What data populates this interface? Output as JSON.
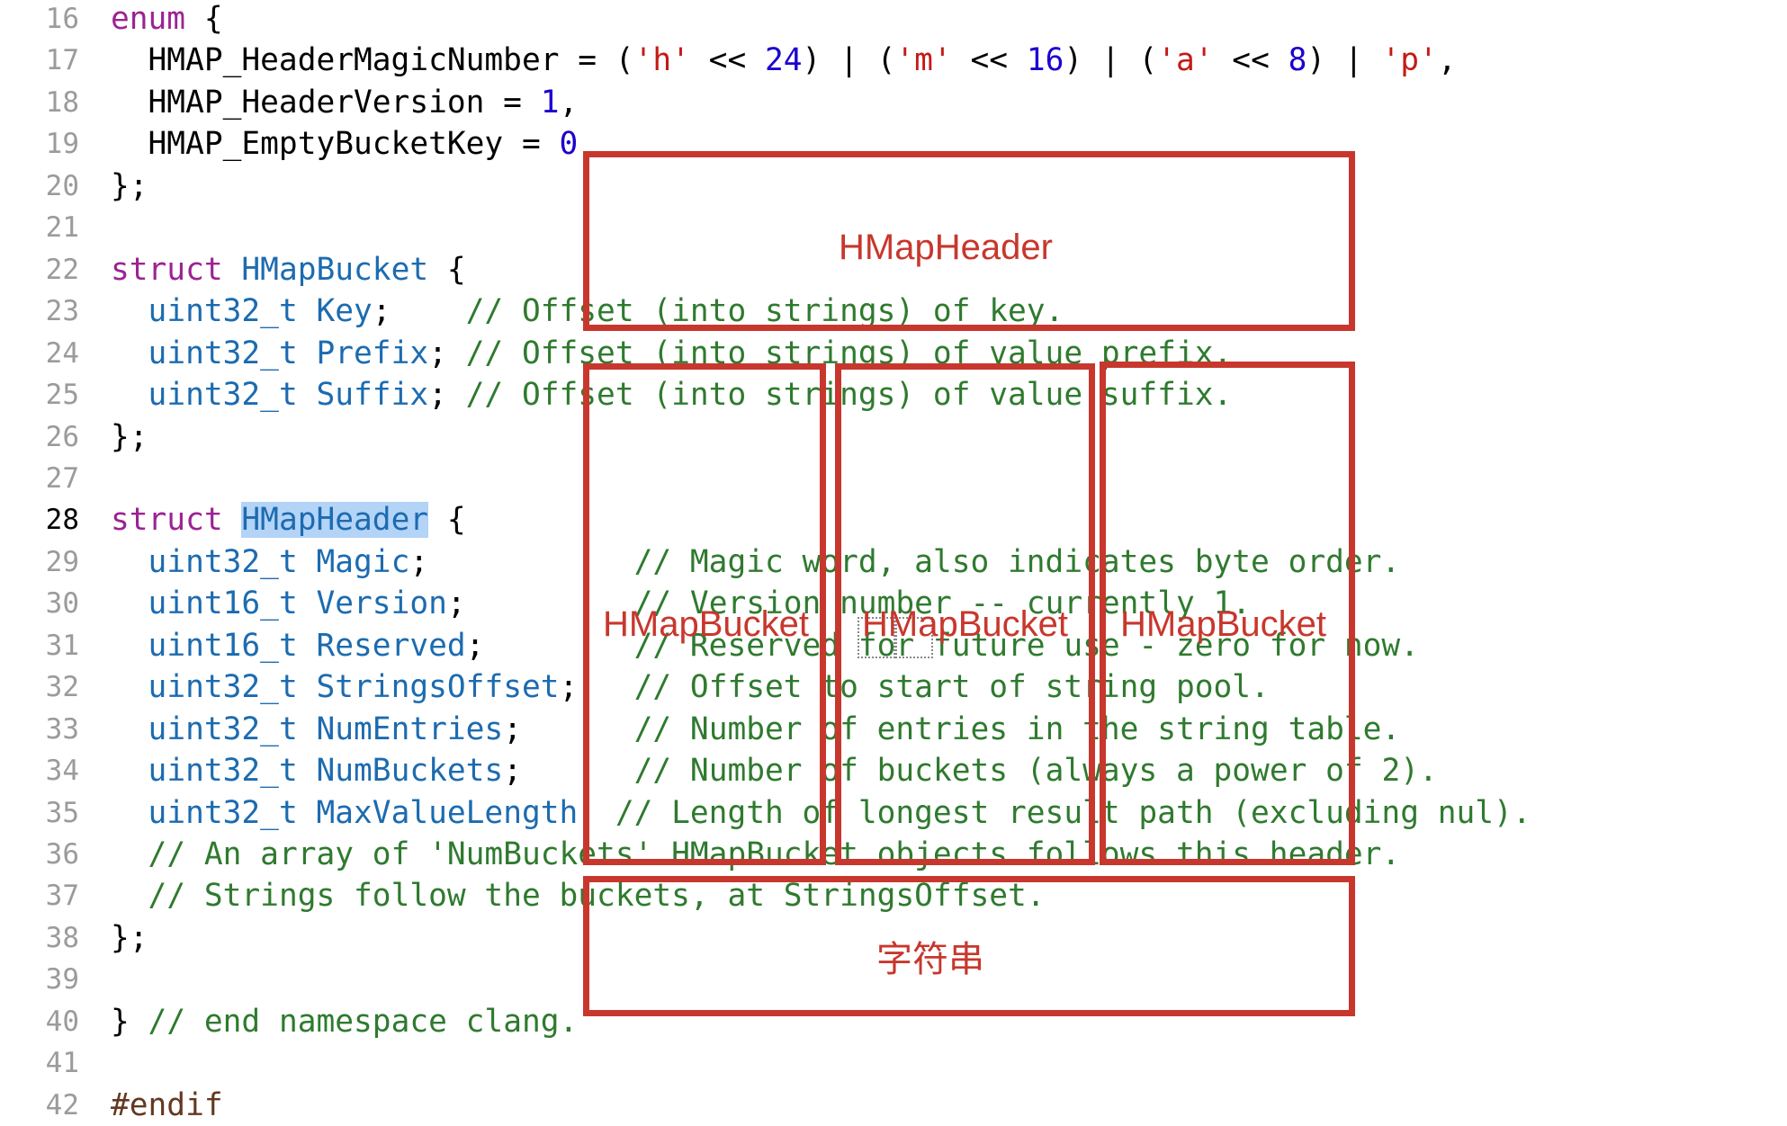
{
  "editor": {
    "current_line": "28",
    "lines": [
      {
        "num": "16",
        "segs": [
          {
            "c": "kw",
            "t": "enum"
          },
          {
            "c": "",
            "t": " {"
          }
        ]
      },
      {
        "num": "17",
        "segs": [
          {
            "c": "",
            "t": "  HMAP_HeaderMagicNumber = ("
          },
          {
            "c": "str",
            "t": "'h'"
          },
          {
            "c": "",
            "t": " << "
          },
          {
            "c": "num",
            "t": "24"
          },
          {
            "c": "",
            "t": ") | ("
          },
          {
            "c": "str",
            "t": "'m'"
          },
          {
            "c": "",
            "t": " << "
          },
          {
            "c": "num",
            "t": "16"
          },
          {
            "c": "",
            "t": ") | ("
          },
          {
            "c": "str",
            "t": "'a'"
          },
          {
            "c": "",
            "t": " << "
          },
          {
            "c": "num",
            "t": "8"
          },
          {
            "c": "",
            "t": ") | "
          },
          {
            "c": "str",
            "t": "'p'"
          },
          {
            "c": "",
            "t": ","
          }
        ]
      },
      {
        "num": "18",
        "segs": [
          {
            "c": "",
            "t": "  HMAP_HeaderVersion = "
          },
          {
            "c": "num",
            "t": "1"
          },
          {
            "c": "",
            "t": ","
          }
        ]
      },
      {
        "num": "19",
        "segs": [
          {
            "c": "",
            "t": "  HMAP_EmptyBucketKey = "
          },
          {
            "c": "num",
            "t": "0"
          }
        ]
      },
      {
        "num": "20",
        "segs": [
          {
            "c": "",
            "t": "};"
          }
        ]
      },
      {
        "num": "21",
        "segs": []
      },
      {
        "num": "22",
        "segs": [
          {
            "c": "kw",
            "t": "struct"
          },
          {
            "c": "",
            "t": " "
          },
          {
            "c": "typ",
            "t": "HMapBucket"
          },
          {
            "c": "",
            "t": " {"
          }
        ]
      },
      {
        "num": "23",
        "segs": [
          {
            "c": "",
            "t": "  "
          },
          {
            "c": "typ",
            "t": "uint32_t Key"
          },
          {
            "c": "",
            "t": ";    "
          },
          {
            "c": "cmt",
            "t": "// Offset (into strings) of key."
          }
        ]
      },
      {
        "num": "24",
        "segs": [
          {
            "c": "",
            "t": "  "
          },
          {
            "c": "typ",
            "t": "uint32_t Prefix"
          },
          {
            "c": "",
            "t": "; "
          },
          {
            "c": "cmt",
            "t": "// Offset (into strings) of value prefix."
          }
        ]
      },
      {
        "num": "25",
        "segs": [
          {
            "c": "",
            "t": "  "
          },
          {
            "c": "typ",
            "t": "uint32_t Suffix"
          },
          {
            "c": "",
            "t": "; "
          },
          {
            "c": "cmt",
            "t": "// Offset (into strings) of value suffix."
          }
        ]
      },
      {
        "num": "26",
        "segs": [
          {
            "c": "",
            "t": "};"
          }
        ]
      },
      {
        "num": "27",
        "segs": []
      },
      {
        "num": "28",
        "segs": [
          {
            "c": "kw",
            "t": "struct"
          },
          {
            "c": "",
            "t": " "
          },
          {
            "c": "typ hl",
            "t": "HMapHeader"
          },
          {
            "c": "",
            "t": " {"
          }
        ]
      },
      {
        "num": "29",
        "segs": [
          {
            "c": "",
            "t": "  "
          },
          {
            "c": "typ",
            "t": "uint32_t Magic"
          },
          {
            "c": "",
            "t": ";           "
          },
          {
            "c": "cmt",
            "t": "// Magic word, also indicates byte order."
          }
        ]
      },
      {
        "num": "30",
        "segs": [
          {
            "c": "",
            "t": "  "
          },
          {
            "c": "typ",
            "t": "uint16_t Version"
          },
          {
            "c": "",
            "t": ";         "
          },
          {
            "c": "cmt",
            "t": "// Version number -- currently 1."
          }
        ]
      },
      {
        "num": "31",
        "segs": [
          {
            "c": "",
            "t": "  "
          },
          {
            "c": "typ",
            "t": "uint16_t Reserved"
          },
          {
            "c": "",
            "t": ";        "
          },
          {
            "c": "cmt",
            "t": "// Reserved for future use - zero for now."
          }
        ]
      },
      {
        "num": "32",
        "segs": [
          {
            "c": "",
            "t": "  "
          },
          {
            "c": "typ",
            "t": "uint32_t StringsOffset"
          },
          {
            "c": "",
            "t": ";   "
          },
          {
            "c": "cmt",
            "t": "// Offset to start of string pool."
          }
        ]
      },
      {
        "num": "33",
        "segs": [
          {
            "c": "",
            "t": "  "
          },
          {
            "c": "typ",
            "t": "uint32_t NumEntries"
          },
          {
            "c": "",
            "t": ";      "
          },
          {
            "c": "cmt",
            "t": "// Number of entries in the string table."
          }
        ]
      },
      {
        "num": "34",
        "segs": [
          {
            "c": "",
            "t": "  "
          },
          {
            "c": "typ",
            "t": "uint32_t NumBuckets"
          },
          {
            "c": "",
            "t": ";      "
          },
          {
            "c": "cmt",
            "t": "// Number of buckets (always a power of 2)."
          }
        ]
      },
      {
        "num": "35",
        "segs": [
          {
            "c": "",
            "t": "  "
          },
          {
            "c": "typ",
            "t": "uint32_t MaxValueLength"
          },
          {
            "c": "",
            "t": "; "
          },
          {
            "c": "cmt",
            "t": "// Length of longest result path (excluding nul)."
          }
        ]
      },
      {
        "num": "36",
        "segs": [
          {
            "c": "",
            "t": "  "
          },
          {
            "c": "cmt",
            "t": "// An array of 'NumBuckets' HMapBucket objects follows this header."
          }
        ]
      },
      {
        "num": "37",
        "segs": [
          {
            "c": "",
            "t": "  "
          },
          {
            "c": "cmt",
            "t": "// Strings follow the buckets, at StringsOffset."
          }
        ]
      },
      {
        "num": "38",
        "segs": [
          {
            "c": "",
            "t": "};"
          }
        ]
      },
      {
        "num": "39",
        "segs": []
      },
      {
        "num": "40",
        "segs": [
          {
            "c": "",
            "t": "} "
          },
          {
            "c": "cmt",
            "t": "// end namespace clang."
          }
        ]
      },
      {
        "num": "41",
        "segs": []
      },
      {
        "num": "42",
        "segs": [
          {
            "c": "pp",
            "t": "#endif"
          }
        ]
      }
    ]
  },
  "annotations": {
    "color": "#c8372d",
    "header_label": "HMapHeader",
    "bucket_label_1": "HMapBucket",
    "bucket_label_2": "HMapBucket",
    "bucket_label_3": "HMapBucket",
    "strings_label": "字符串"
  }
}
